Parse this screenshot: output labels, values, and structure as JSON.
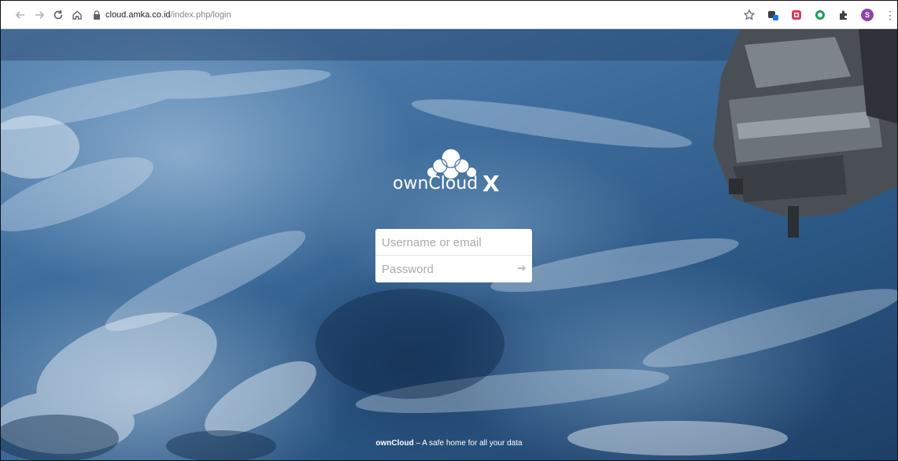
{
  "browser": {
    "url_host": "cloud.amka.co.id",
    "url_path": "/index.php/login",
    "avatar_initial": "S",
    "icons": [
      "back-arrow-icon",
      "forward-arrow-icon",
      "reload-icon",
      "home-icon",
      "lock-icon",
      "star-icon",
      "extension-icon",
      "puzzle-icon",
      "more-icon"
    ]
  },
  "logo": {
    "text": "ownCloud",
    "suffix": "X"
  },
  "login": {
    "username_placeholder": "Username or email",
    "username_value": "",
    "password_placeholder": "Password",
    "password_value": ""
  },
  "footer": {
    "brand": "ownCloud",
    "tagline": " – A safe home for all your data"
  },
  "colors": {
    "background_blue": "#3f6e9e",
    "field_bg": "#ffffff",
    "placeholder": "#aaaaaa"
  }
}
